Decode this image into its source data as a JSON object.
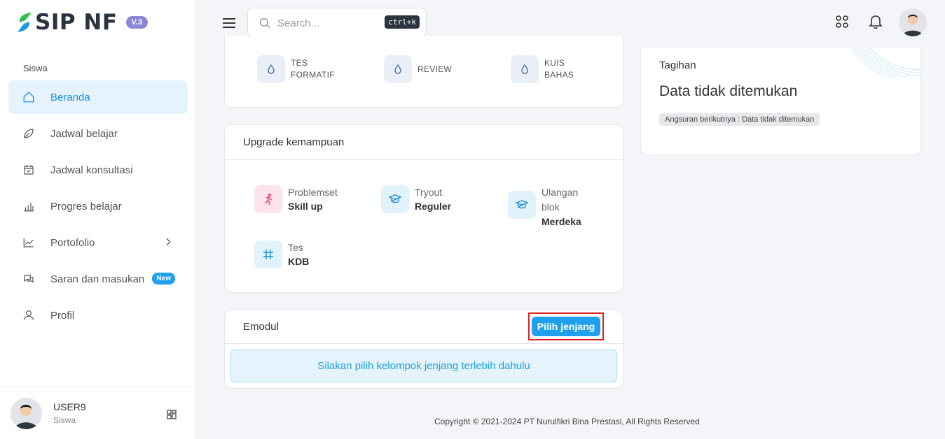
{
  "brand": {
    "name": "SIP NF",
    "version": "V.3"
  },
  "sidebar": {
    "section": "Siswa",
    "items": [
      {
        "label": "Beranda",
        "icon": "home-icon"
      },
      {
        "label": "Jadwal belajar",
        "icon": "leaf-icon"
      },
      {
        "label": "Jadwal konsultasi",
        "icon": "calendar-check-icon"
      },
      {
        "label": "Progres belajar",
        "icon": "bar-chart-icon"
      },
      {
        "label": "Portofolio",
        "icon": "line-chart-icon"
      },
      {
        "label": "Saran dan masukan",
        "icon": "chat-icon",
        "badge": "New"
      },
      {
        "label": "Profil",
        "icon": "user-icon"
      }
    ],
    "user": {
      "name": "USER9",
      "role": "Siswa"
    }
  },
  "topbar": {
    "search_placeholder": "Search...",
    "shortcut": "ctrl+k"
  },
  "quiz": {
    "items": [
      {
        "line1": "TES",
        "line2": "FORMATIF"
      },
      {
        "line1": "REVIEW"
      },
      {
        "line1": "KUIS",
        "line2": "BAHAS"
      }
    ]
  },
  "upgrade": {
    "title": "Upgrade kemampuan",
    "items": [
      {
        "label": "Problemset",
        "value": "Skill up"
      },
      {
        "label": "Tryout",
        "value": "Reguler"
      },
      {
        "label1": "Ulangan",
        "label2": "blok",
        "value": "Merdeka"
      },
      {
        "label": "Tes",
        "value": "KDB"
      }
    ]
  },
  "emodul": {
    "title": "Emodul",
    "button": "Pilih jenjang",
    "info": "Silakan pilih kelompok jenjang terlebih dahulu"
  },
  "tagihan": {
    "title": "Tagihan",
    "value": "Data tidak ditemukan",
    "chip": "Angsuran berikutnya : Data tidak ditemukan"
  },
  "footer": "Copyright © 2021-2024 PT Nurulfikri Bina Prestasi, All Rights Reserved",
  "colors": {
    "accent": "#1fa0ef",
    "active_bg": "#e7f3fc",
    "version_badge": "#8b87d6"
  }
}
